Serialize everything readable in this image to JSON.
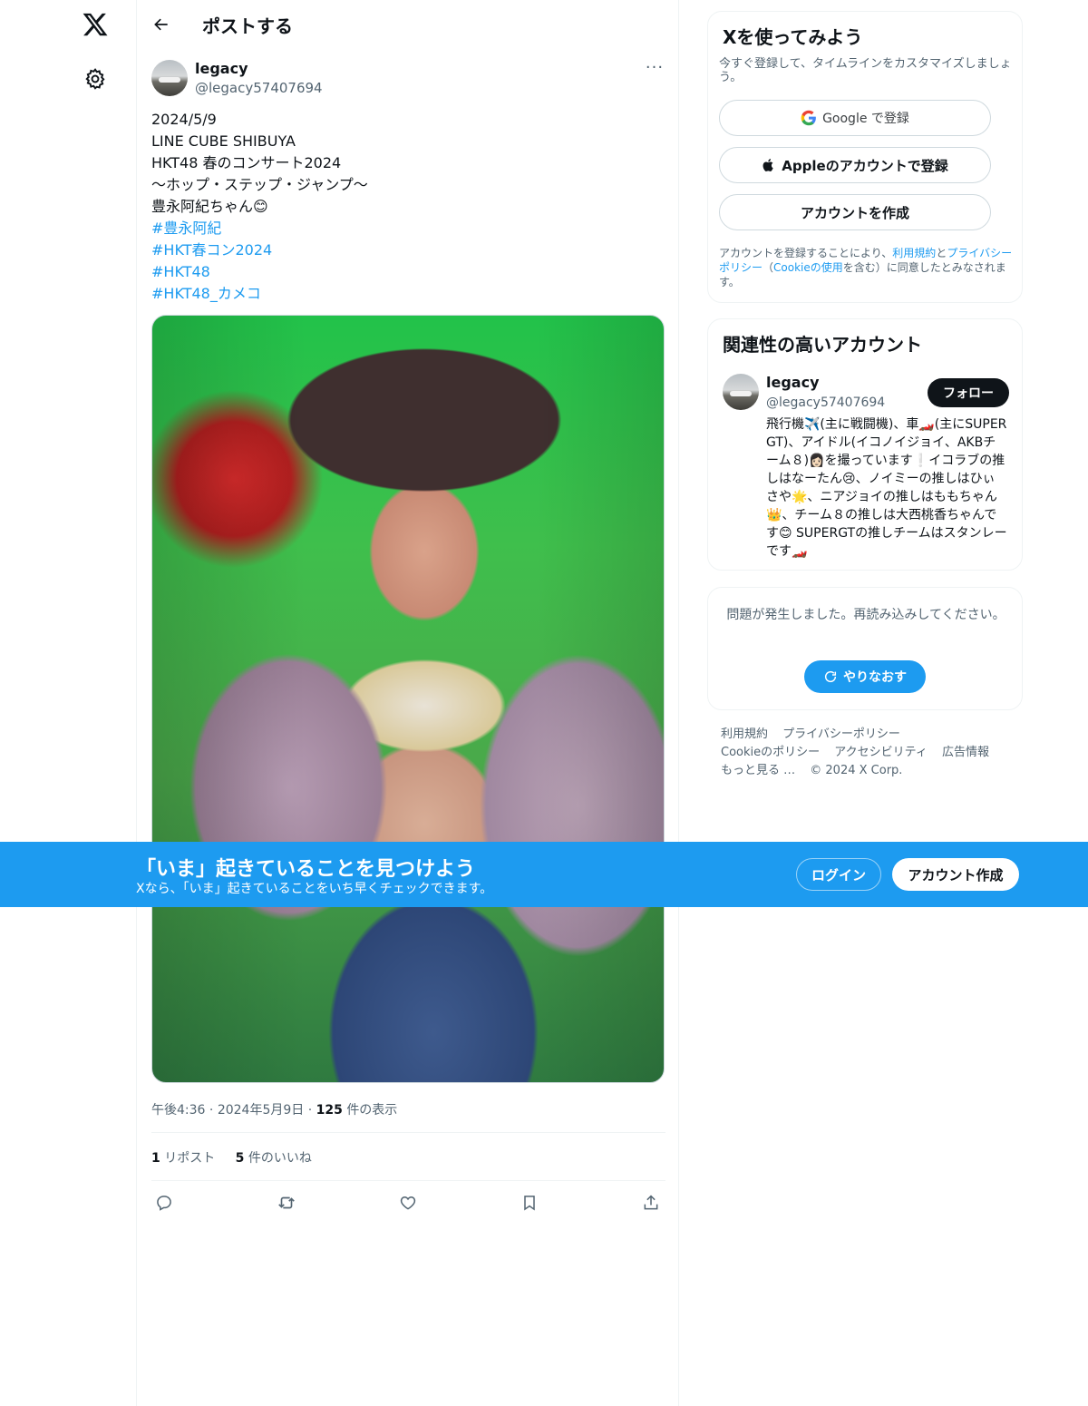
{
  "nav": {
    "logo_icon": "x-logo-icon",
    "settings_icon": "gear-icon"
  },
  "header": {
    "back_icon": "arrow-left-icon",
    "title": "ポストする"
  },
  "post": {
    "author_name": "legacy",
    "author_handle": "@legacy57407694",
    "more_label": "···",
    "lines": [
      "2024/5/9",
      "LINE CUBE SHIBUYA",
      "HKT48 春のコンサート2024",
      "〜ホップ・ステップ・ジャンプ〜",
      "豊永阿紀ちゃん😊"
    ],
    "hashtags": [
      "#豊永阿紀",
      "#HKT春コン2024",
      "#HKT48",
      "#HKT48_カメコ"
    ],
    "time": "午後4:36",
    "date": "2024年5月9日",
    "views_count": "125",
    "views_label": "件の表示",
    "reposts_count": "1",
    "reposts_label": "リポスト",
    "likes_count": "5",
    "likes_label": "件のいいね",
    "action_icons": [
      "reply-icon",
      "repost-icon",
      "like-icon",
      "bookmark-icon",
      "share-icon"
    ]
  },
  "signup_card": {
    "title": "Xを使ってみよう",
    "subtitle": "今すぐ登録して、タイムラインをカスタマイズしましょう。",
    "google_label": "Google で登録",
    "apple_label": "Appleのアカウントで登録",
    "create_label": "アカウントを作成",
    "legal_1": "アカウントを登録することにより、",
    "legal_terms": "利用規約",
    "legal_and": "と",
    "legal_privacy": "プライバシーポリシー",
    "legal_open": "（",
    "legal_cookie": "Cookieの使用",
    "legal_2": "を含む）に同意したとみなされます。"
  },
  "related": {
    "title": "関連性の高いアカウント",
    "name": "legacy",
    "handle": "@legacy57407694",
    "follow_label": "フォロー",
    "bio": "飛行機✈️(主に戦闘機)、車🏎️(主にSUPER GT)、アイドル(イコノイジョイ、AKBチーム８)👩🏻を撮っています❕イコラブの推しはなーたん😢、ノイミーの推しはひぃさや🌟、ニアジョイの推しはももちゃん👑、チーム８の推しは大西桃香ちゃんです😊 SUPERGTの推しチームはスタンレーです🏎️"
  },
  "error_card": {
    "message": "問題が発生しました。再読み込みしてください。",
    "retry_label": "やりなおす"
  },
  "footer": {
    "links": [
      "利用規約",
      "プライバシーポリシー",
      "Cookieのポリシー",
      "アクセシビリティ",
      "広告情報",
      "もっと見る …",
      "© 2024 X Corp."
    ]
  },
  "banner": {
    "title": "「いま」起きていることを見つけよう",
    "subtitle": "Xなら、「いま」起きていることをいち早くチェックできます。",
    "login_label": "ログイン",
    "signup_label": "アカウント作成"
  },
  "colors": {
    "accent": "#1d9bf0",
    "text": "#0f1419",
    "muted": "#536471",
    "border": "#eff3f4"
  }
}
